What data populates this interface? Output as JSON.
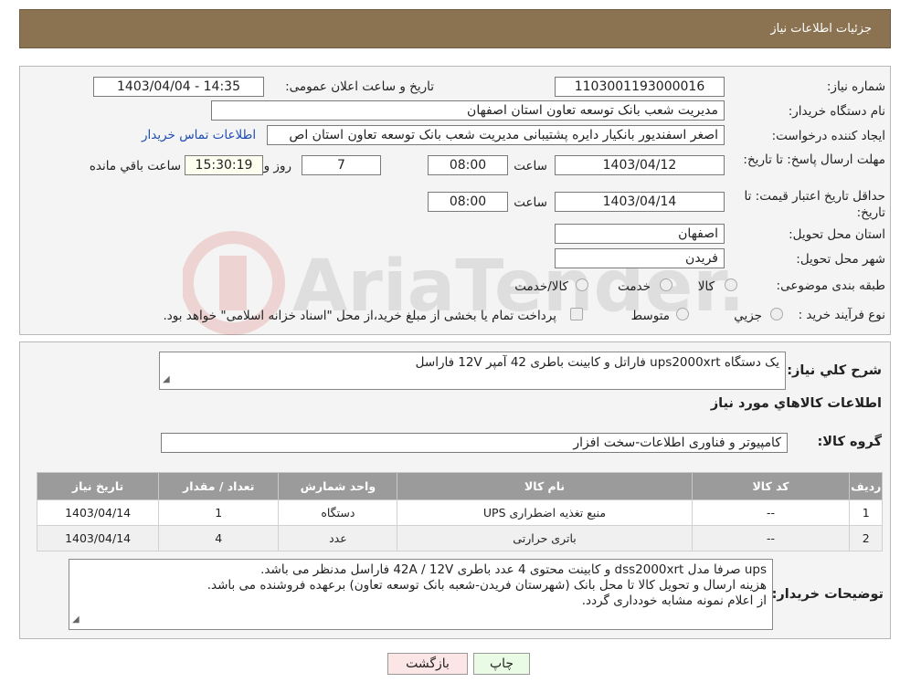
{
  "header": {
    "title": "جزئیات اطلاعات نیاز"
  },
  "fields": {
    "need_number_label": "شماره نیاز:",
    "need_number": "1103001193000016",
    "announce_label": "تاریخ و ساعت اعلان عمومی:",
    "announce_value": "1403/04/04 - 14:35",
    "buyer_label": "نام دستگاه خریدار:",
    "buyer_value": "مدیریت شعب بانک توسعه تعاون استان اصفهان",
    "creator_label": "ایجاد کننده درخواست:",
    "creator_value": "اصغر اسفندیور بانکیار دایره پشتیبانی مدیریت شعب بانک توسعه تعاون استان اص",
    "contact_link": "اطلاعات تماس خریدار",
    "deadline_label": "مهلت ارسال پاسخ: تا تاریخ:",
    "deadline_date": "1403/04/12",
    "time_label": "ساعت",
    "deadline_time": "08:00",
    "days": "7",
    "days_label": "روز و",
    "remaining": "15:30:19",
    "remaining_label": "ساعت باقي مانده",
    "validity_label": "حداقل تاریخ اعتبار قیمت: تا تاریخ:",
    "validity_date": "1403/04/14",
    "validity_time_label": "ساعت",
    "validity_time": "08:00",
    "province_label": "استان محل تحویل:",
    "province_value": "اصفهان",
    "city_label": "شهر محل تحویل:",
    "city_value": "فریدن",
    "category_label": "طبقه بندی موضوعی:",
    "category_options": [
      "کالا",
      "خدمت",
      "کالا/خدمت"
    ],
    "process_label": "نوع فرآیند خرید :",
    "process_options": [
      "جزیي",
      "متوسط"
    ],
    "process_note": "پرداخت تمام یا بخشی از مبلغ خرید،از محل \"اسناد خزانه اسلامی\" خواهد بود."
  },
  "summary": {
    "desc_label": "شرح كلي نياز:",
    "desc_value": "یک دستگاه ups2000xrt فاراتل و کابینت باطری 42 آمپر 12V فاراسل",
    "goods_info_title": "اطلاعات كالاهاي مورد نياز",
    "group_label": "گروه كالا:",
    "group_value": "کامپیوتر و فناوری اطلاعات-سخت افزار"
  },
  "table": {
    "headers": [
      "ردیف",
      "کد کالا",
      "نام کالا",
      "واحد شمارش",
      "تعداد / مقدار",
      "تاریخ نیاز"
    ],
    "rows": [
      [
        "1",
        "--",
        "منبع تغذیه اضطراری UPS",
        "دستگاه",
        "1",
        "1403/04/14"
      ],
      [
        "2",
        "--",
        "باتری حرارتی",
        "عدد",
        "4",
        "1403/04/14"
      ]
    ]
  },
  "notes": {
    "label": "توضیحات خریدار:",
    "lines": [
      "ups صرفا مدل dss2000xrt و کابینت محتوی 4 عدد باطری 42A  /  12V فاراسل مدنظر می باشد.",
      "هزینه ارسال و تحویل کالا تا محل بانک (شهرستان فریدن-شعبه بانک توسعه تعاون) برعهده فروشنده می باشد.",
      "از اعلام نمونه مشابه خودداری گردد."
    ]
  },
  "buttons": {
    "print": "چاپ",
    "back": "بازگشت"
  },
  "colors": {
    "header": "#8b7352",
    "table_header": "#9b9b9b",
    "link": "#1f4db3"
  }
}
